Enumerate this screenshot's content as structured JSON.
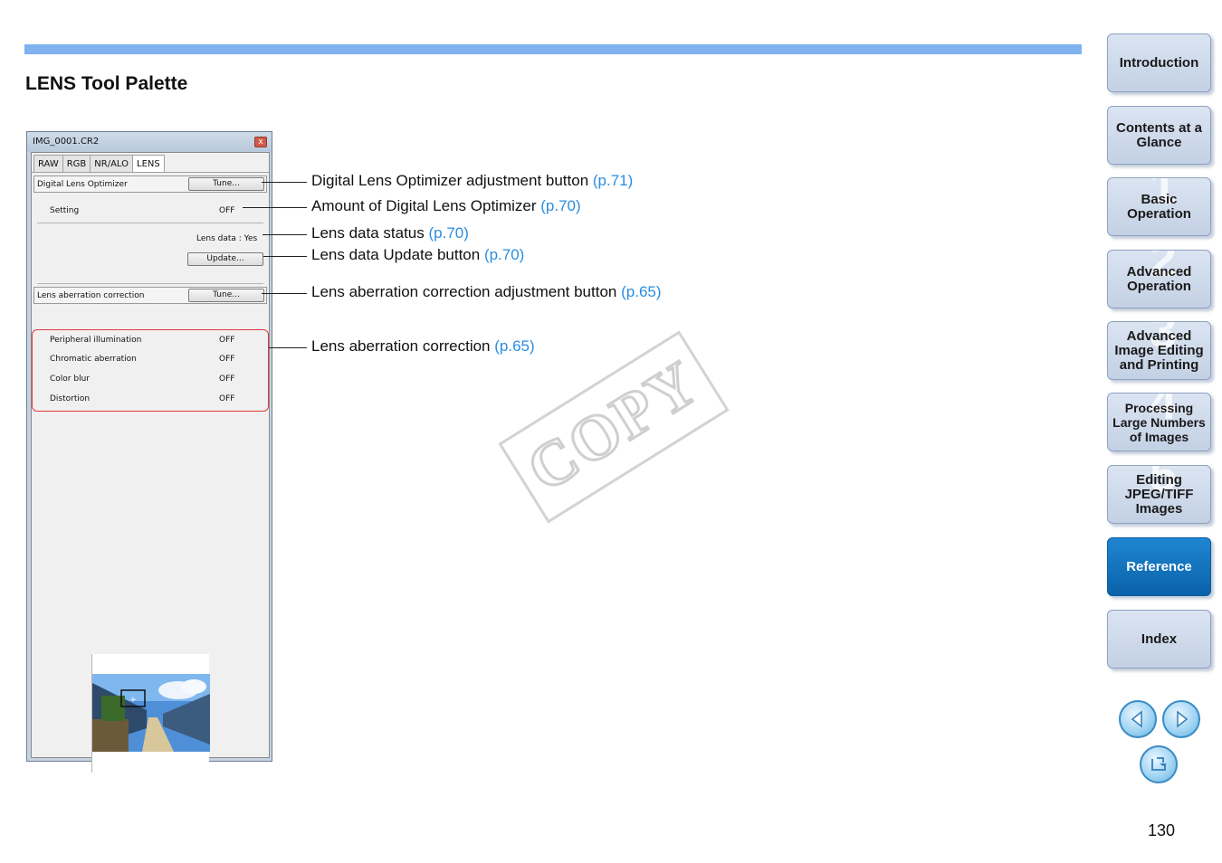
{
  "page": {
    "section_title": "LENS Tool Palette",
    "page_number": "130",
    "watermark": "COPY"
  },
  "palette": {
    "window_title": "IMG_0001.CR2",
    "close_glyph": "x",
    "tabs": [
      "RAW",
      "RGB",
      "NR/ALO",
      "LENS"
    ],
    "active_tab": "LENS",
    "dlo_label": "Digital Lens Optimizer",
    "tune_label": "Tune...",
    "setting_label": "Setting",
    "setting_value": "OFF",
    "lens_data_status": "Lens data : Yes",
    "update_label": "Update...",
    "aberration_label": "Lens aberration correction",
    "aberration_items": [
      {
        "label": "Peripheral illumination",
        "value": "OFF"
      },
      {
        "label": "Chromatic aberration",
        "value": "OFF"
      },
      {
        "label": "Color blur",
        "value": "OFF"
      },
      {
        "label": "Distortion",
        "value": "OFF"
      }
    ]
  },
  "callouts": [
    {
      "text": "Digital Lens Optimizer adjustment button",
      "ref": "(p.71)"
    },
    {
      "text": "Amount of Digital Lens Optimizer",
      "ref": "(p.70)"
    },
    {
      "text": "Lens data status",
      "ref": "(p.70)"
    },
    {
      "text": "Lens data Update button",
      "ref": "(p.70)"
    },
    {
      "text": "Lens aberration correction adjustment button",
      "ref": "(p.65)"
    },
    {
      "text": "Lens aberration correction",
      "ref": "(p.65)"
    }
  ],
  "nav": [
    {
      "label": "Introduction",
      "number": ""
    },
    {
      "label": "Contents at a Glance",
      "number": ""
    },
    {
      "label": "Basic Operation",
      "number": "1"
    },
    {
      "label": "Advanced Operation",
      "number": "2"
    },
    {
      "label": "Advanced Image Editing and Printing",
      "number": "3"
    },
    {
      "label": "Processing Large Numbers of Images",
      "number": "4"
    },
    {
      "label": "Editing JPEG/TIFF Images",
      "number": "5"
    },
    {
      "label": "Reference",
      "number": ""
    },
    {
      "label": "Index",
      "number": ""
    }
  ],
  "nav_active": "Reference",
  "colors": {
    "accent_bar": "#7fb2ef",
    "reference_link": "#2a8de0",
    "highlight_box": "#e23c3c",
    "nav_active": "#0a62aa"
  },
  "icons": [
    "close-icon",
    "prev-page-icon",
    "next-page-icon",
    "return-icon"
  ]
}
